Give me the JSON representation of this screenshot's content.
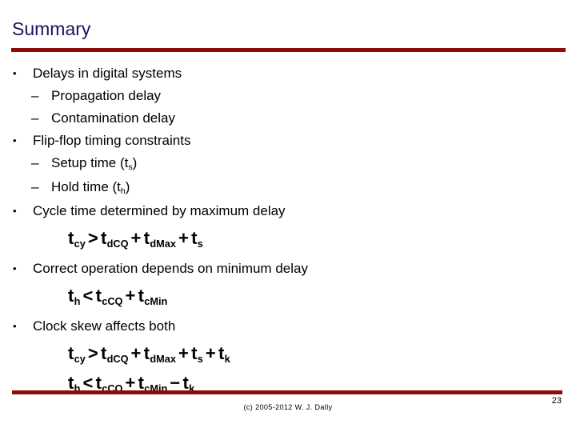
{
  "slide": {
    "title": "Summary",
    "title_color": "#15155c",
    "rule_color": "#8f0b0b",
    "background_color": "#ffffff"
  },
  "bullets": [
    {
      "level": 1,
      "marker": "•",
      "text": "Delays in digital systems"
    },
    {
      "level": 2,
      "marker": "–",
      "text": "Propagation delay"
    },
    {
      "level": 2,
      "marker": "–",
      "text": "Contamination delay"
    },
    {
      "level": 1,
      "marker": "•",
      "text": "Flip-flop timing constraints"
    },
    {
      "level": 2,
      "marker": "–",
      "text": "Setup time (t",
      "sub": "s",
      "text_tail": ")"
    },
    {
      "level": 2,
      "marker": "–",
      "text": "Hold time (t",
      "sub": "h",
      "text_tail": ")"
    },
    {
      "level": 1,
      "marker": "•",
      "text": "Cycle time determined by maximum delay"
    },
    {
      "level": 1,
      "marker": "•",
      "text": "Correct operation depends on minimum delay"
    },
    {
      "level": 1,
      "marker": "•",
      "text": "Clock skew affects both"
    }
  ],
  "equations": {
    "eq1": {
      "plain": "tcy > tdCQ + tdMax + ts",
      "terms": [
        {
          "base": "t",
          "sub": "cy"
        },
        {
          "op": ">"
        },
        {
          "base": "t",
          "sub": "dCQ"
        },
        {
          "op": "+"
        },
        {
          "base": "t",
          "sub": "dMax"
        },
        {
          "op": "+"
        },
        {
          "base": "t",
          "sub": "s"
        }
      ]
    },
    "eq2": {
      "plain": "th < tcCQ + tcMin",
      "terms": [
        {
          "base": "t",
          "sub": "h"
        },
        {
          "op": "<"
        },
        {
          "base": "t",
          "sub": "cCQ"
        },
        {
          "op": "+"
        },
        {
          "base": "t",
          "sub": "cMin"
        }
      ]
    },
    "eq3": {
      "plain": "tcy > tdCQ + tdMax + ts + tk",
      "terms": [
        {
          "base": "t",
          "sub": "cy"
        },
        {
          "op": ">"
        },
        {
          "base": "t",
          "sub": "dCQ"
        },
        {
          "op": "+"
        },
        {
          "base": "t",
          "sub": "dMax"
        },
        {
          "op": "+"
        },
        {
          "base": "t",
          "sub": "s"
        },
        {
          "op": "+"
        },
        {
          "base": "t",
          "sub": "k"
        }
      ]
    },
    "eq4": {
      "plain": "th < tcCQ + tcMin - tk",
      "terms": [
        {
          "base": "t",
          "sub": "h"
        },
        {
          "op": "<"
        },
        {
          "base": "t",
          "sub": "cCQ"
        },
        {
          "op": "+"
        },
        {
          "base": "t",
          "sub": "cMin"
        },
        {
          "op": "−"
        },
        {
          "base": "t",
          "sub": "k"
        }
      ]
    }
  },
  "footer": {
    "copyright": "(c) 2005-2012 W. J. Dally",
    "page_number": "23"
  }
}
